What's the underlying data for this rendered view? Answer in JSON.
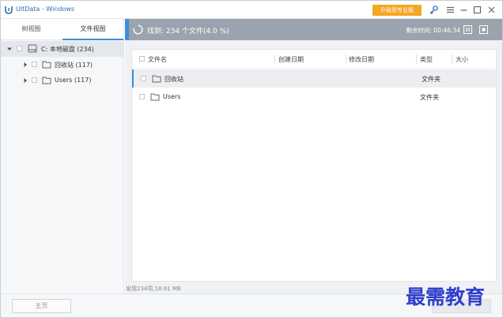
{
  "title_bar": {
    "app_title": "UltData - Windows",
    "upgrade_label": "升级到专业版",
    "icons": [
      "app-logo-icon",
      "key-icon",
      "menu-icon",
      "minimize-icon",
      "maximize-icon",
      "close-icon"
    ]
  },
  "sidebar": {
    "tabs": [
      {
        "label": "树视图",
        "active": false
      },
      {
        "label": "文件视图",
        "active": true
      }
    ],
    "tree": [
      {
        "label": "C: 本地磁盘 (234)",
        "selected": true,
        "icon": "drive-icon"
      },
      {
        "label": "回收站 (117)",
        "selected": false,
        "icon": "folder-icon"
      },
      {
        "label": "Users (117)",
        "selected": false,
        "icon": "folder-icon"
      }
    ]
  },
  "scan": {
    "status": "找到: 234 个文件(4.0 %)",
    "progress_percent": 4.0,
    "remaining_label": "剩余时间: 00:46:34",
    "icons": [
      "spinner-icon",
      "pause-icon",
      "stop-icon"
    ]
  },
  "file_table": {
    "columns": [
      "文件名",
      "创建日期",
      "修改日期",
      "类型",
      "大小"
    ],
    "rows": [
      {
        "name": "回收站",
        "created": "",
        "modified": "",
        "type": "文件夹",
        "size": "",
        "selected": true
      },
      {
        "name": "Users",
        "created": "",
        "modified": "",
        "type": "文件夹",
        "size": "",
        "selected": false
      }
    ]
  },
  "summary": "发现234项,18.61 MB",
  "bottom": {
    "home_label": "主页"
  },
  "watermark": "最需教育",
  "colors": {
    "accent": "#3d8fd8",
    "upgrade": "#f5a623",
    "scan_bar": "#9aa3ae",
    "watermark": "#2f3fcb"
  }
}
